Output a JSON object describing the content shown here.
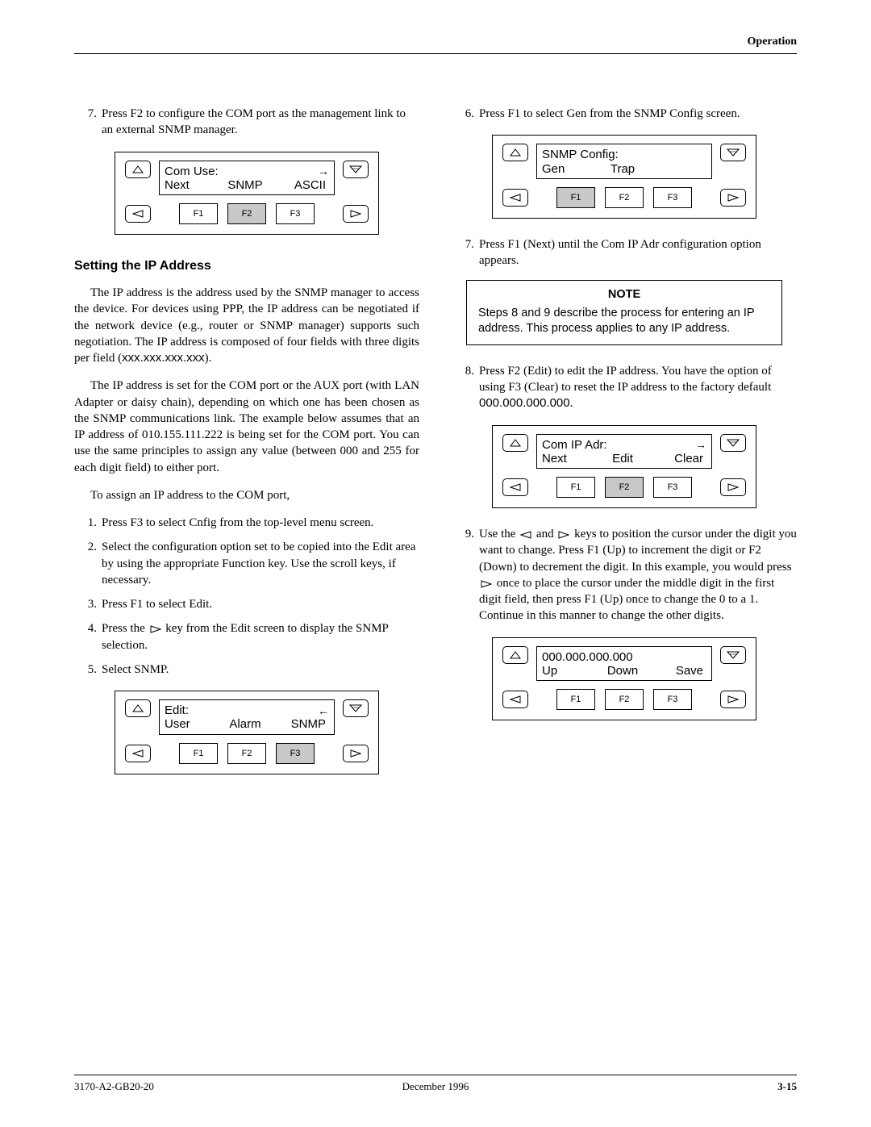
{
  "header": {
    "section": "Operation"
  },
  "left": {
    "step7": {
      "n": "7.",
      "t": "Press F2 to configure the COM port as the management link to an external SNMP manager."
    },
    "panel1": {
      "line1": "Com Use:",
      "opts": [
        "Next",
        "SNMP",
        "ASCII"
      ],
      "hl": 1
    },
    "h3": "Setting the IP Address",
    "p1": "The IP address is the address used by the SNMP manager to access the device. For devices using PPP, the IP address can be negotiated if the network device (e.g., router or SNMP manager) supports such negotiation. The IP address is composed of four fields with three digits per field (",
    "p1mono": "xxx.xxx.xxx.xxx",
    "p1end": ").",
    "p2": "The IP address is set for the COM port or the AUX port (with LAN Adapter or daisy chain), depending on which one has been chosen as the SNMP communications link. The example below assumes that an IP address of 010.155.111.222 is being set for the COM port. You can use the same principles to assign any value (between 000 and 255 for each digit field) to either port.",
    "p3": "To assign an IP address to the COM port,",
    "steps": [
      {
        "n": "1.",
        "t": "Press F3 to select Cnfig from the top-level menu screen."
      },
      {
        "n": "2.",
        "t": "Select the configuration option set to be copied into the Edit area by using the appropriate Function key. Use the scroll keys, if necessary."
      },
      {
        "n": "3.",
        "t": "Press F1 to select Edit."
      },
      {
        "n": "4.",
        "pre": "Press the ",
        "post": " key from the Edit screen to display the SNMP selection."
      },
      {
        "n": "5.",
        "t": "Select SNMP."
      }
    ],
    "panel2": {
      "line1": "Edit:",
      "opts": [
        "User",
        "Alarm",
        "SNMP"
      ],
      "hl": 2,
      "arrow": "left"
    }
  },
  "right": {
    "step6": {
      "n": "6.",
      "t": "Press F1 to select Gen from the SNMP Config screen."
    },
    "panel3": {
      "line1": "SNMP Config:",
      "opts": [
        "Gen",
        "Trap",
        ""
      ],
      "hl": 0
    },
    "step7": {
      "n": "7.",
      "t": "Press F1 (Next) until the Com IP Adr configuration option appears."
    },
    "note": {
      "title": "NOTE",
      "body": "Steps 8 and 9 describe the process for entering an IP address. This process applies to any IP address."
    },
    "step8": {
      "n": "8.",
      "pre": "Press F2 (Edit) to edit the IP address. You have the option of using F3 (Clear) to reset the IP address to the factory default ",
      "mono": "000.000.000.000",
      "post": "."
    },
    "panel4": {
      "line1": "Com IP Adr:",
      "opts": [
        "Next",
        "Edit",
        "Clear"
      ],
      "hl": 1
    },
    "step9": {
      "n": "9.",
      "a": "Use the ",
      "b": " and ",
      "c": " keys to position the cursor under the digit you want to change. Press F1 (Up) to increment the digit or F2 (Down) to decrement the digit. In this example, you would press ",
      "d": " once to place the cursor under the middle digit in the first digit field, then press F1 (Up) once to change the 0 to a 1. Continue in this manner to change the other digits."
    },
    "panel5": {
      "line1": "000.000.000.000",
      "opts": [
        "Up",
        "Down",
        "Save"
      ],
      "hl": -1,
      "noarrow": true
    }
  },
  "fkeys": [
    "F1",
    "F2",
    "F3"
  ],
  "footer": {
    "left": "3170-A2-GB20-20",
    "center": "December 1996",
    "right": "3-15"
  }
}
